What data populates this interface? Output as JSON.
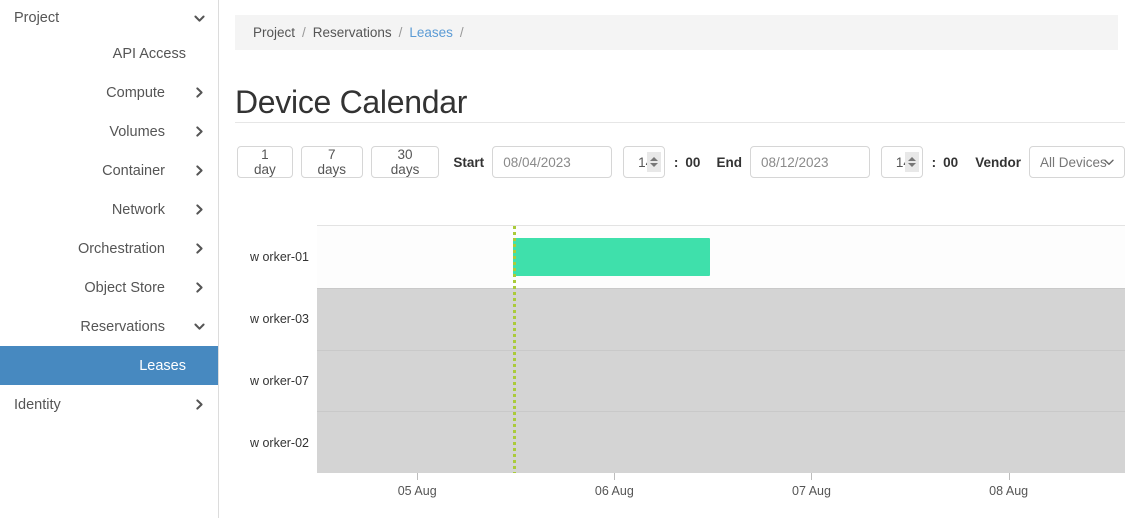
{
  "sidebar": {
    "items": [
      {
        "label": "Project",
        "icon": "chevron-down-icon",
        "align": "left",
        "active": false,
        "expandable": true
      },
      {
        "label": "API Access",
        "icon": "none",
        "align": "right",
        "active": false,
        "expandable": false
      },
      {
        "label": "Compute",
        "icon": "chevron-right-icon",
        "align": "center",
        "active": false,
        "expandable": true
      },
      {
        "label": "Volumes",
        "icon": "chevron-right-icon",
        "align": "center",
        "active": false,
        "expandable": true
      },
      {
        "label": "Container",
        "icon": "chevron-right-icon",
        "align": "center",
        "active": false,
        "expandable": true
      },
      {
        "label": "Network",
        "icon": "chevron-right-icon",
        "align": "center",
        "active": false,
        "expandable": true
      },
      {
        "label": "Orchestration",
        "icon": "chevron-right-icon",
        "align": "center",
        "active": false,
        "expandable": true
      },
      {
        "label": "Object Store",
        "icon": "chevron-right-icon",
        "align": "center",
        "active": false,
        "expandable": true
      },
      {
        "label": "Reservations",
        "icon": "chevron-down-icon",
        "align": "center",
        "active": false,
        "expandable": true
      },
      {
        "label": "Leases",
        "icon": "none",
        "align": "right",
        "active": true,
        "expandable": false
      },
      {
        "label": "Identity",
        "icon": "chevron-right-icon",
        "align": "left",
        "active": false,
        "expandable": true
      }
    ],
    "active_color": "#4789c0"
  },
  "breadcrumb": {
    "items": [
      "Project",
      "Reservations",
      "Leases"
    ],
    "separator": "/",
    "trailing_separator": "/",
    "link_color": "#5b9bd5"
  },
  "header": {
    "title": "Device Calendar"
  },
  "toolbar": {
    "range_buttons": [
      "1 day",
      "7 days",
      "30 days"
    ],
    "start_label": "Start",
    "start_date": "08/04/2023",
    "start_hour": "14",
    "start_minute": "00",
    "end_label": "End",
    "end_date": "08/12/2023",
    "end_hour": "14",
    "end_minute": "00",
    "time_separator": ":",
    "vendor_label": "Vendor",
    "vendor_value": "All Devices",
    "vendor_caret": "chevron-down-icon"
  },
  "chart_data": {
    "type": "bar",
    "title": "Device Calendar",
    "orientation": "horizontal-gantt",
    "xlabel": "",
    "ylabel": "",
    "grid": false,
    "legend": null,
    "categories": [
      "worker-01",
      "worker-03",
      "worker-07",
      "worker-02"
    ],
    "row_labels_rendered": [
      "w orker-01",
      "w orker-03",
      "w orker-07",
      "w orker-02"
    ],
    "row_shading": [
      "light",
      "dark",
      "dark",
      "dark"
    ],
    "x_axis": {
      "tick_labels": [
        "05 Aug",
        "06 Aug",
        "07 Aug",
        "08 Aug"
      ],
      "tick_positions_pct": [
        12.4,
        36.8,
        61.2,
        85.6
      ],
      "range_start": "08/04/2023 14:00",
      "range_end": "08/12/2023 14:00"
    },
    "now_marker": {
      "label": "now",
      "position_pct": 24.3,
      "color": "#aacb3a",
      "style": "dotted"
    },
    "bars": [
      {
        "row": "worker-01",
        "row_index": 0,
        "start_pct": 24.3,
        "end_pct": 48.6,
        "color": "#3fe0ab",
        "label": ""
      }
    ]
  }
}
